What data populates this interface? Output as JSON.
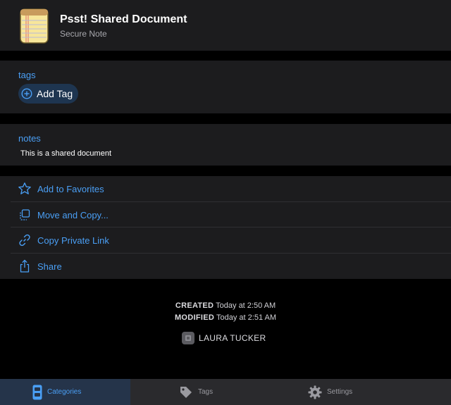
{
  "item": {
    "title": "Psst! Shared Document",
    "type": "Secure Note"
  },
  "tags": {
    "label": "tags",
    "add_label": "Add Tag"
  },
  "notes": {
    "label": "notes",
    "text": "This is a shared document"
  },
  "actions": [
    {
      "label": "Add to Favorites",
      "icon": "star-icon"
    },
    {
      "label": "Move and Copy...",
      "icon": "move-copy-icon"
    },
    {
      "label": "Copy Private Link",
      "icon": "link-icon"
    },
    {
      "label": "Share",
      "icon": "share-icon"
    }
  ],
  "meta": {
    "created_key": "CREATED",
    "created_value": "Today at 2:50 AM",
    "modified_key": "MODIFIED",
    "modified_value": "Today at 2:51 AM"
  },
  "owner": {
    "name": "LAURA TUCKER"
  },
  "tabbar": {
    "tabs": [
      {
        "label": "Categories",
        "icon": "categories-icon",
        "active": true
      },
      {
        "label": "Tags",
        "icon": "tag-icon",
        "active": false
      },
      {
        "label": "Settings",
        "icon": "gear-icon",
        "active": false
      }
    ]
  },
  "colors": {
    "accent": "#4a9ff5",
    "background": "#000000",
    "panel": "#1c1c1e",
    "tabbar": "#2a2a2d"
  }
}
